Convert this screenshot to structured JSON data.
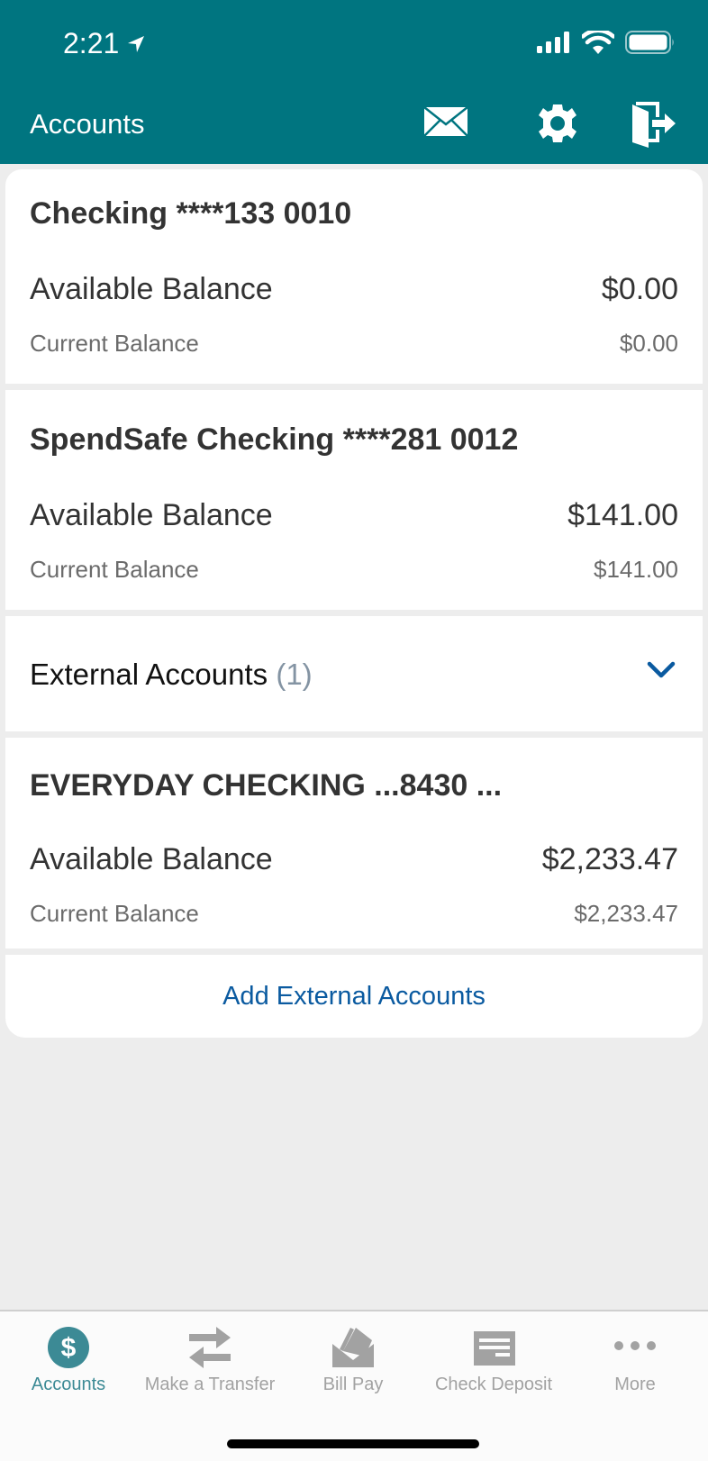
{
  "status_bar": {
    "time": "2:21",
    "location_icon": "location-arrow-icon",
    "signal_icon": "cellular-signal-icon",
    "wifi_icon": "wifi-icon",
    "battery_icon": "battery-icon"
  },
  "header": {
    "title": "Accounts",
    "actions": [
      {
        "name": "messages",
        "icon": "mail-icon"
      },
      {
        "name": "settings",
        "icon": "gear-icon"
      },
      {
        "name": "logout",
        "icon": "logout-door-icon"
      }
    ],
    "background_color": "#007580"
  },
  "accounts": [
    {
      "title": "Checking ****133 0010",
      "available_label": "Available Balance",
      "available_value": "$0.00",
      "current_label": "Current Balance",
      "current_value": "$0.00"
    },
    {
      "title": "SpendSafe Checking ****281 0012",
      "available_label": "Available Balance",
      "available_value": "$141.00",
      "current_label": "Current Balance",
      "current_value": "$141.00"
    }
  ],
  "external": {
    "title": "External Accounts",
    "count": "(1)",
    "toggle_icon": "chevron-down-icon",
    "accounts": [
      {
        "title": "EVERYDAY CHECKING ...8430 ...",
        "available_label": "Available Balance",
        "available_value": "$2,233.47",
        "current_label": "Current Balance",
        "current_value": "$2,233.47"
      }
    ],
    "add_label": "Add External Accounts",
    "link_color": "#0a5aa0"
  },
  "tabbar": {
    "active_color": "#3c8a95",
    "inactive_color": "#a2a2a2",
    "tabs": [
      {
        "label": "Accounts",
        "icon": "dollar-circle-icon",
        "active": true
      },
      {
        "label": "Make a Transfer",
        "icon": "transfer-arrows-icon",
        "active": false
      },
      {
        "label": "Bill Pay",
        "icon": "bill-envelope-icon",
        "active": false
      },
      {
        "label": "Check Deposit",
        "icon": "check-icon",
        "active": false
      },
      {
        "label": "More",
        "icon": "more-dots-icon",
        "active": false
      }
    ]
  }
}
